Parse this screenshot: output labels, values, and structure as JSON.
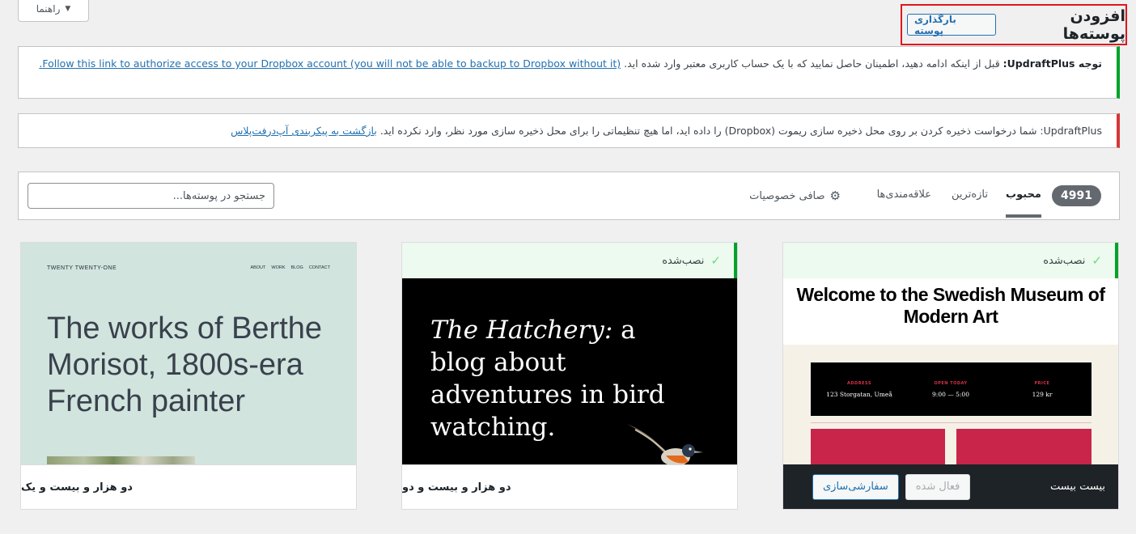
{
  "help_tab": {
    "label": "راهنما"
  },
  "header": {
    "title": "افزودن پوسته‌ها",
    "upload_label": "بارگذاری پوسته"
  },
  "notices": {
    "dropbox_auth": {
      "prefix": "توجه UpdraftPlus:",
      "text": " قبل از اینکه ادامه دهید، اطمینان حاصل نمایید که با یک حساب کاربری معتبر وارد شده اید. ",
      "link": "Follow this link to authorize access to your Dropbox account (you will not be able to backup to Dropbox without it)."
    },
    "remote_storage": {
      "text": "UpdraftPlus: شما درخواست ذخیره کردن بر روی محل ذخیره سازی ریموت (Dropbox) را داده اید، اما هیچ تنظیماتی را برای محل ذخیره سازی مورد نظر، وارد نکرده اید. ",
      "link": "بازگشت به پیکربندی آپ‌درفت‌پلاس"
    }
  },
  "filter_bar": {
    "count": "4991",
    "tabs": {
      "popular": "محبوب",
      "latest": "تازه‌ترین",
      "favorites": "علاقه‌مندی‌ها",
      "feature_filter": "صافی خصوصیات"
    },
    "search_placeholder": "جستجو در پوسته‌ها..."
  },
  "themes": [
    {
      "name": "دو هزار و بیست و یک",
      "installed": false,
      "preview": {
        "site_title": "TWENTY TWENTY-ONE",
        "nav": [
          "ABOUT",
          "WORK",
          "BLOG",
          "CONTACT"
        ],
        "headline": "The works of Berthe Morisot, 1800s-era French painter"
      }
    },
    {
      "name": "دو هزار و بیست و دو",
      "installed": true,
      "installed_label": "نصب‌شده",
      "preview": {
        "headline_italic": "The Hatchery:",
        "headline_rest": " a blog about adventures in bird watching."
      }
    },
    {
      "name": "بیست بیست",
      "installed": true,
      "installed_label": "نصب‌شده",
      "active": true,
      "activated_label": "فعال شده",
      "customize_label": "سفارشی‌سازی",
      "preview": {
        "headline": "Welcome to the Swedish Museum of Modern Art",
        "info": [
          {
            "label": "ADDRESS",
            "value": "123 Storgatan, Umeå"
          },
          {
            "label": "OPEN TODAY",
            "value": "9:00 — 5:00"
          },
          {
            "label": "PRICE",
            "value": "129 kr"
          }
        ]
      }
    }
  ],
  "colors": {
    "accent": "#2271b1",
    "success": "#00a32a",
    "error": "#d63638",
    "highlight": "#e0161b"
  },
  "icons": {
    "help_caret": "caret-down-icon",
    "feature_filter": "gear-icon",
    "installed": "check-icon"
  }
}
